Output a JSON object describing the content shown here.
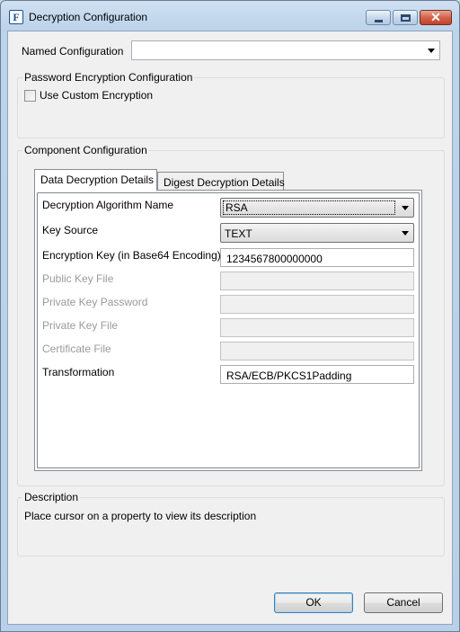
{
  "window": {
    "title": "Decryption Configuration",
    "app_icon_letter": "F"
  },
  "named_configuration": {
    "label": "Named Configuration",
    "value": ""
  },
  "password_group": {
    "title": "Password Encryption Configuration",
    "use_custom_encryption_label": "Use Custom Encryption",
    "use_custom_encryption_checked": false
  },
  "component_group": {
    "title": "Component Configuration",
    "tabs": [
      {
        "label": "Data Decryption Details",
        "active": true
      },
      {
        "label": "Digest Decryption Details",
        "active": false
      }
    ],
    "fields": {
      "algorithm_label": "Decryption Algorithm Name",
      "algorithm_value": "RSA",
      "key_source_label": "Key Source",
      "key_source_value": "TEXT",
      "encryption_key_label": "Encryption Key (in Base64 Encoding)",
      "encryption_key_value": "1234567800000000",
      "public_key_file_label": "Public Key File",
      "public_key_file_value": "",
      "private_key_password_label": "Private Key Password",
      "private_key_password_value": "",
      "private_key_file_label": "Private Key File",
      "private_key_file_value": "",
      "certificate_file_label": "Certificate File",
      "certificate_file_value": "",
      "transformation_label": "Transformation",
      "transformation_value": "RSA/ECB/PKCS1Padding"
    }
  },
  "description": {
    "title": "Description",
    "text": "Place cursor on a property to view its description"
  },
  "buttons": {
    "ok": "OK",
    "cancel": "Cancel"
  }
}
